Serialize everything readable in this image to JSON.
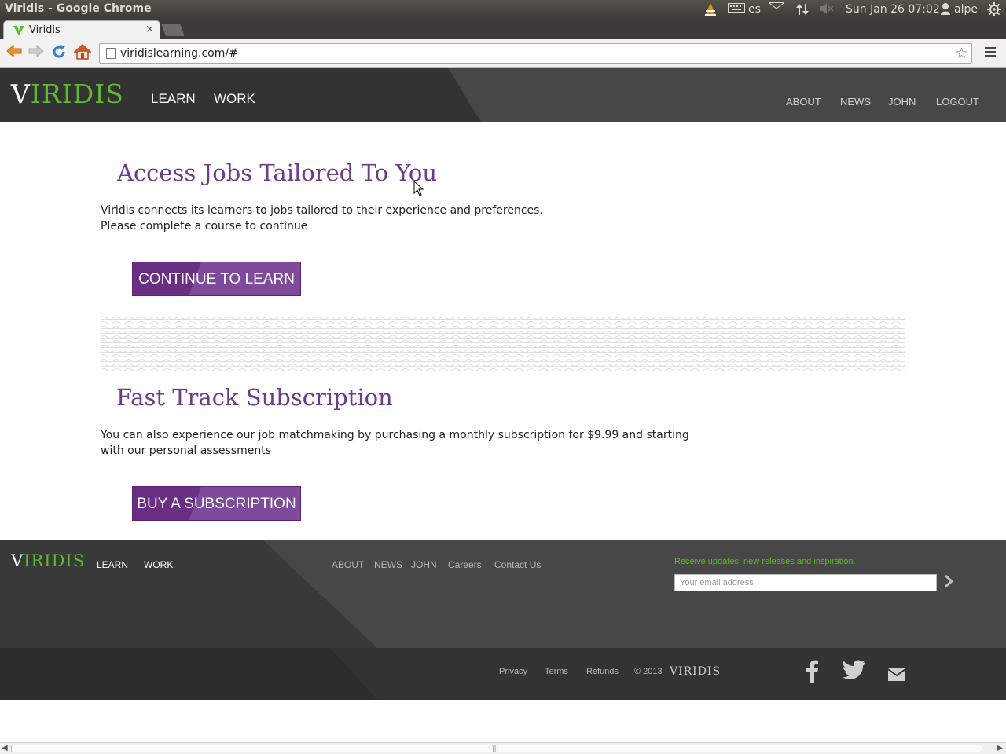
{
  "os": {
    "window_title": "Viridis - Google Chrome",
    "keyboard_layout": "es",
    "clock": "Sun Jan 26 07:02",
    "user": "alpe"
  },
  "browser": {
    "tab_title": "Viridis",
    "tab_close": "×",
    "url": "viridislearning.com/#"
  },
  "header": {
    "logo_v": "V",
    "logo_rest": "IRIDIS",
    "nav_left": [
      "LEARN",
      "WORK"
    ],
    "nav_right": [
      "ABOUT",
      "NEWS",
      "JOHN",
      "LOGOUT"
    ]
  },
  "main": {
    "jobs": {
      "title": "Access Jobs Tailored To You",
      "line1": "Viridis connects its learners to jobs tailored to their experience and preferences.",
      "line2": "Please complete a course to continue",
      "button": "CONTINUE TO LEARN"
    },
    "subscription": {
      "title": "Fast Track Subscription",
      "line1": "You can also experience our job matchmaking by purchasing a monthly subscription for $9.99 and starting",
      "line2": "with our personal assessments",
      "button": "BUY A SUBSCRIPTION"
    }
  },
  "footer": {
    "logo_v": "V",
    "logo_rest": "IRIDIS",
    "nav_left": [
      "LEARN",
      "WORK"
    ],
    "nav_mid": [
      "ABOUT",
      "NEWS",
      "JOHN",
      "Careers",
      "Contact Us"
    ],
    "newsletter_label": "Receive updates, new releases and inspiration.",
    "email_placeholder": "Your email address",
    "legal": [
      "Privacy",
      "Terms",
      "Refunds"
    ],
    "copyright": "© 2013",
    "bottom_logo": "VIRIDIS"
  },
  "colors": {
    "brand_green": "#5dbb2c",
    "brand_purple": "#6f3a8a",
    "header_bg": "#333333"
  }
}
